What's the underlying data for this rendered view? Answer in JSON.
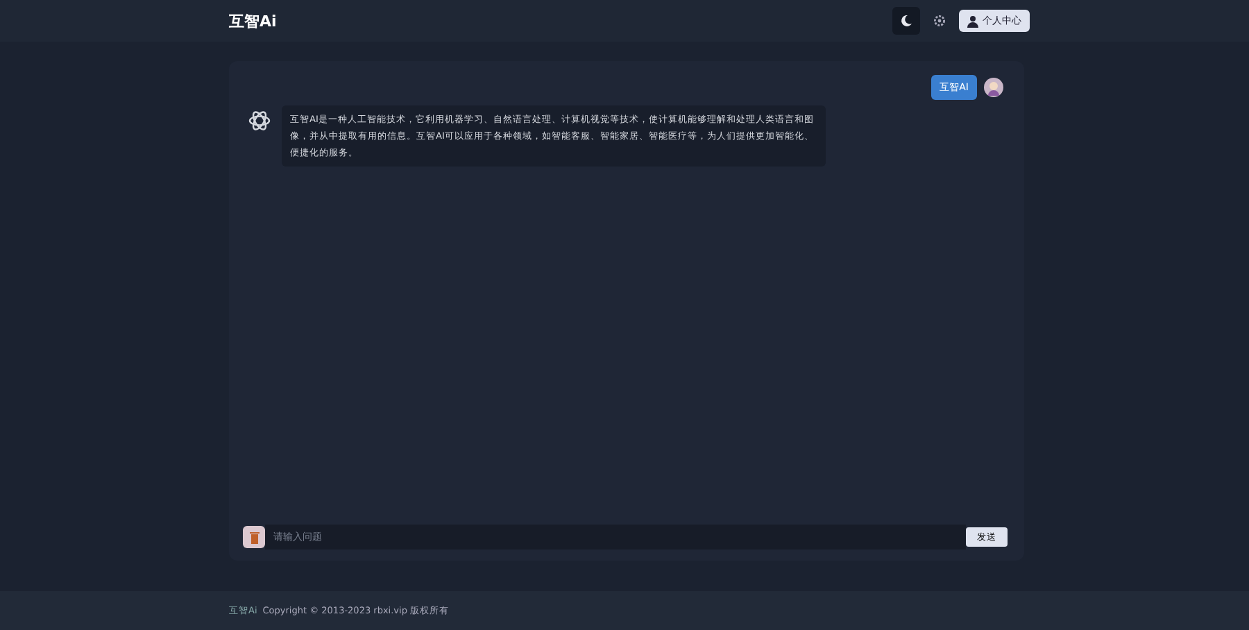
{
  "header": {
    "brand": "互智Ai",
    "profile_button": "个人中心"
  },
  "messages": [
    {
      "kind": "user",
      "text": "互智AI"
    },
    {
      "kind": "bot",
      "text": "互智AI是一种人工智能技术，它利用机器学习、自然语言处理、计算机视觉等技术，使计算机能够理解和处理人类语言和图像，并从中提取有用的信息。互智AI可以应用于各种领域，如智能客服、智能家居、智能医疗等，为人们提供更加智能化、便捷化的服务。"
    }
  ],
  "input": {
    "placeholder": "请输入问题",
    "send_button": "发送"
  },
  "footer": {
    "brand": "互智Ai",
    "copyright": "Copyright © 2013-2023 rbxi.vip 版权所有"
  }
}
